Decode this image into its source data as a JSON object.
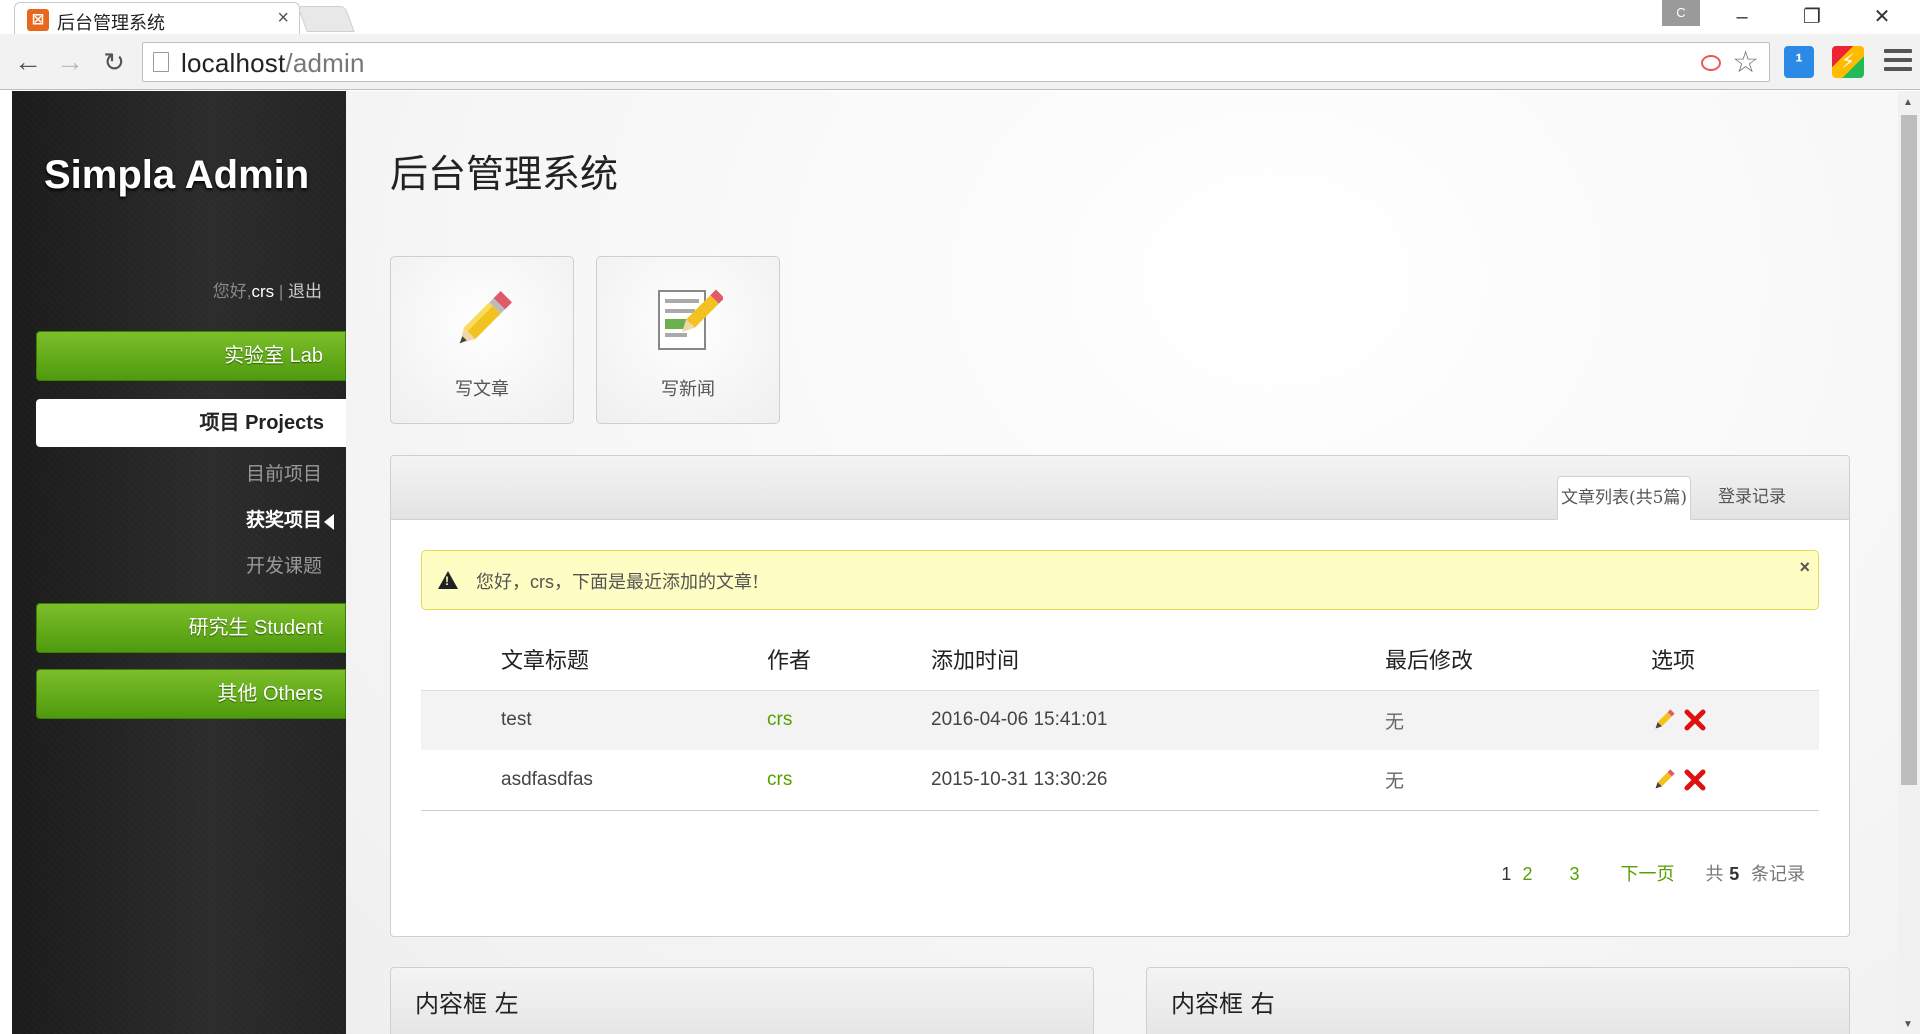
{
  "browser": {
    "tab_title": "后台管理系统",
    "tab_close": "×",
    "user_badge": "C",
    "url_host": "localhost",
    "url_path": "/admin"
  },
  "sidebar": {
    "logo": "Simpla Admin",
    "greeting_prefix": "您好,",
    "username": "crs",
    "separator": " | ",
    "logout": "退出",
    "nav": [
      {
        "label": "实验室 Lab"
      },
      {
        "label": "项目 Projects"
      },
      {
        "label": "研究生 Student"
      },
      {
        "label": "其他 Others"
      }
    ],
    "subnav": [
      {
        "label": "目前项目"
      },
      {
        "label": "获奖项目"
      },
      {
        "label": "开发课题"
      }
    ]
  },
  "main": {
    "page_title": "后台管理系统",
    "shortcuts": [
      {
        "label": "写文章",
        "icon": "pencil-icon"
      },
      {
        "label": "写新闻",
        "icon": "edit-note-icon"
      }
    ],
    "box": {
      "tabs": [
        {
          "label": "文章列表(共5篇)"
        },
        {
          "label": "登录记录"
        }
      ],
      "notice": {
        "prefix": "您好，",
        "user": "crs",
        "suffix": "，下面是最近添加的文章!",
        "close": "×"
      },
      "table": {
        "headers": [
          "文章标题",
          "作者",
          "添加时间",
          "最后修改",
          "选项"
        ],
        "rows": [
          {
            "title": "test",
            "author": "crs",
            "added": "2016-04-06 15:41:01",
            "modified": "无"
          },
          {
            "title": "asdfasdfas",
            "author": "crs",
            "added": "2015-10-31 13:30:26",
            "modified": "无"
          }
        ]
      },
      "pagination": {
        "current": "1",
        "pages": [
          "2",
          "3"
        ],
        "next": "下一页",
        "total_prefix": "共",
        "total": "5",
        "total_suffix": "条记录"
      }
    },
    "left_box_title": "内容框 左",
    "right_box_title": "内容框 右"
  },
  "colors": {
    "accent_green": "#57a000",
    "nav_green": "#6aaf1c",
    "sidebar_bg": "#262626",
    "notice_bg": "#fefdc3"
  }
}
